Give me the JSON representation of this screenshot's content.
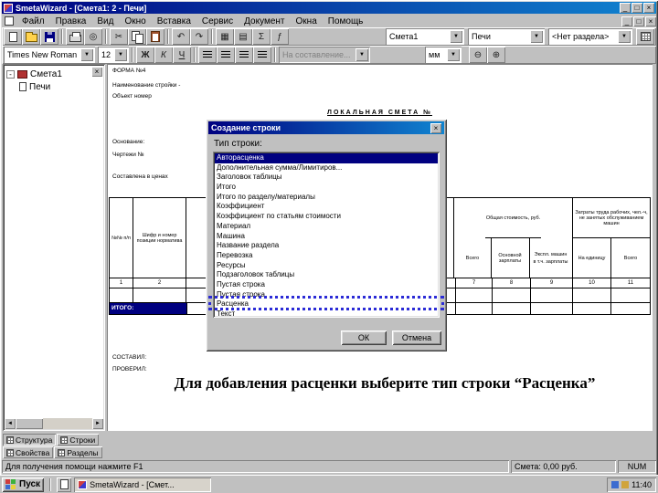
{
  "window": {
    "title": "SmetaWizard - [Смета1: 2 - Печи]"
  },
  "menu": {
    "items": [
      "Файл",
      "Правка",
      "Вид",
      "Окно",
      "Вставка",
      "Сервис",
      "Документ",
      "Окна",
      "Помощь"
    ]
  },
  "toolbar1": {
    "sheet": "Смета1",
    "object": "Печи",
    "section": "<Нет раздела>"
  },
  "toolbar2": {
    "font": "Times New Roman",
    "size": "12",
    "bold": "Ж",
    "italic": "К",
    "underline": "Ч",
    "mode": "На составление...",
    "units": "мм"
  },
  "tree": {
    "root": "Смета1",
    "child": "Печи"
  },
  "document": {
    "form": "ФОРМА №4",
    "building": "Наименование стройки -",
    "object_line": "Объект номер",
    "title": "ЛОКАЛЬНАЯ СМЕТА №",
    "basis": "Основание:",
    "drawings": "Чертежи №",
    "prices": "Составлена в ценах",
    "composed": "СОСТАВИЛ:",
    "checked": "ПРОВЕРИЛ:"
  },
  "table": {
    "col_num": "№№ п/п",
    "col_code": "Шифр и номер позиции норматива",
    "group_cost": "Общая стоимость, руб.",
    "cost_total": "Всего",
    "cost_salary": "Основной зарплаты",
    "cost_machines": "Экспл. машин",
    "cost_machines_sub": "в т.ч. зарплаты",
    "group_labor": "Затраты труда рабочих, чел.-ч, не занятых обслуживанием машин",
    "labor_unit": "На единицу",
    "labor_total": "Всего",
    "nums": [
      "1",
      "2",
      "7",
      "8",
      "9",
      "10",
      "11"
    ],
    "itogo": "ИТОГО:"
  },
  "dialog": {
    "title": "Создание строки",
    "label": "Тип строки:",
    "items": [
      "Авторасценка",
      "Дополнительная сумма/Лимитиров...",
      "Заголовок таблицы",
      "Итого",
      "Итого по разделу/материалы",
      "Коэффициент",
      "Коэффициент по статьям стоимости",
      "Материал",
      "Машина",
      "Название раздела",
      "Перевозка",
      "Ресурсы",
      "Подзаголовок таблицы",
      "Пустая строка",
      "Пустая строка",
      "Расценка",
      "Текст"
    ],
    "ok": "ОК",
    "cancel": "Отмена"
  },
  "caption": "Для добавления расценки выберите тип строки “Расценка”",
  "tabs": [
    "Структура",
    "Строки",
    "Свойства",
    "Разделы"
  ],
  "statusbar": {
    "help": "Для получения помощи нажмите F1",
    "total": "Смета: 0,00 руб.",
    "num": "NUM"
  },
  "taskbar": {
    "start": "Пуск",
    "task": "SmetaWizard - [Смет...",
    "time": "11:40"
  },
  "icons": {
    "minimize": "_",
    "maximize": "□",
    "close": "×",
    "dropdown": "▼",
    "cut": "✂",
    "undo": "↶",
    "redo": "↷",
    "sum": "Σ",
    "wizard": "ƒ",
    "preview": "◎",
    "zoom_in": "⊕",
    "zoom_out": "⊖",
    "arrow_left": "◄",
    "arrow_right": "►",
    "collapse": "-",
    "insert_row": "▦",
    "delete_row": "▤"
  },
  "colors": {
    "titlebar_start": "#000080",
    "titlebar_end": "#1084d0",
    "selection": "#000080",
    "annotation": "#2b2bd6"
  }
}
